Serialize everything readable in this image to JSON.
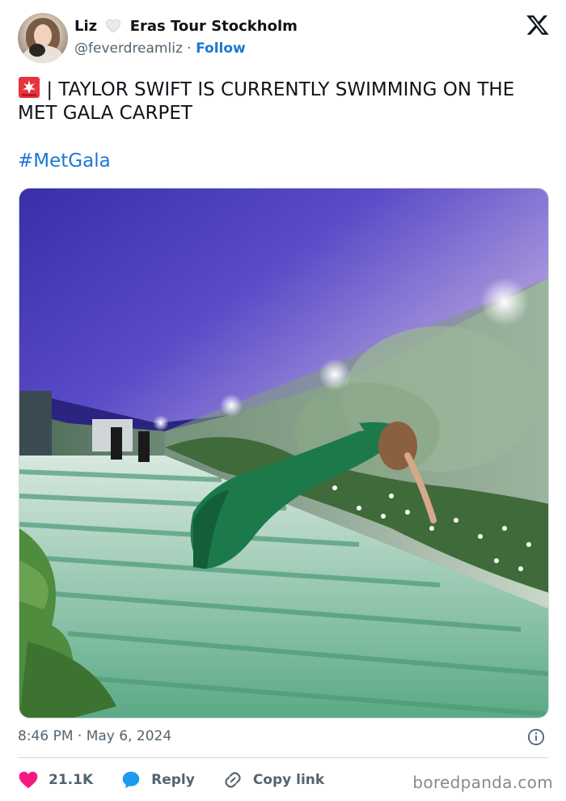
{
  "author": {
    "name_first": "Liz",
    "name_rest": "Eras Tour Stockholm",
    "handle": "@feverdreamliz",
    "separator": "·",
    "follow_label": "Follow"
  },
  "tweet": {
    "text": "| TAYLOR SWIFT IS CURRENTLY SWIMMING ON THE MET GALA CARPET",
    "hashtag": "#MetGala",
    "timestamp": "8:46 PM · May 6, 2024"
  },
  "actions": {
    "likes": "21.1K",
    "reply_label": "Reply",
    "copy_label": "Copy link"
  },
  "watermark": "boredpanda.com",
  "colors": {
    "link": "#1d77d0",
    "like": "#f91880",
    "reply": "#1d9bf0",
    "text_secondary": "#536471"
  },
  "icons": [
    "white-heart-icon",
    "x-logo-icon",
    "siren-icon",
    "info-icon",
    "heart-icon",
    "reply-bubble-icon",
    "link-icon"
  ]
}
